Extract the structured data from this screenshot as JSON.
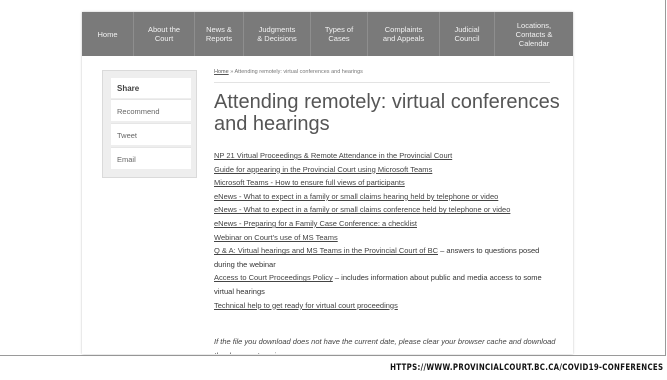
{
  "nav": {
    "items": [
      "Home",
      "About the\nCourt",
      "News &\nReports",
      "Judgments\n& Decisions",
      "Types of\nCases",
      "Complaints\nand Appeals",
      "Judicial\nCouncil",
      "Locations,\nContacts &\nCalendar"
    ]
  },
  "sidebar": {
    "title": "Share",
    "items": [
      "Recommend",
      "Tweet",
      "Email"
    ]
  },
  "breadcrumb": {
    "home": "Home",
    "rest": " » Attending remotely: virtual conferences and hearings"
  },
  "page": {
    "title": "Attending remotely: virtual conferences and hearings"
  },
  "links": [
    {
      "link": "NP 21 Virtual Proceedings & Remote Attendance in the Provincial Court"
    },
    {
      "link": "Guide for appearing in the Provincial Court using Microsoft Teams"
    },
    {
      "link": "Microsoft Teams - How to ensure full views of participants"
    },
    {
      "link": "eNews - What to expect in a family or small claims hearing held by telephone or video"
    },
    {
      "link": "eNews - What to expect in a family or small claims conference held by telephone or video"
    },
    {
      "link": "eNews - Preparing for a Family Case Conference: a checklist"
    },
    {
      "link": "Webinar on Court's use of MS Teams"
    },
    {
      "link": "Q & A: Virtual hearings and MS Teams in the Provincial Court of BC",
      "suffix": " – answers to questions posed during the webinar"
    },
    {
      "link": "Access to Court Proceedings Policy",
      "suffix": " – includes information about public and media access to some virtual hearings"
    },
    {
      "link": "Technical help to get ready for virtual court proceedings"
    }
  ],
  "note": "If the file you download does not have the current date, please clear your browser cache and download the document again.",
  "source_url": "HTTPS://WWW.PROVINCIALCOURT.BC.CA/COVID19-CONFERENCES"
}
